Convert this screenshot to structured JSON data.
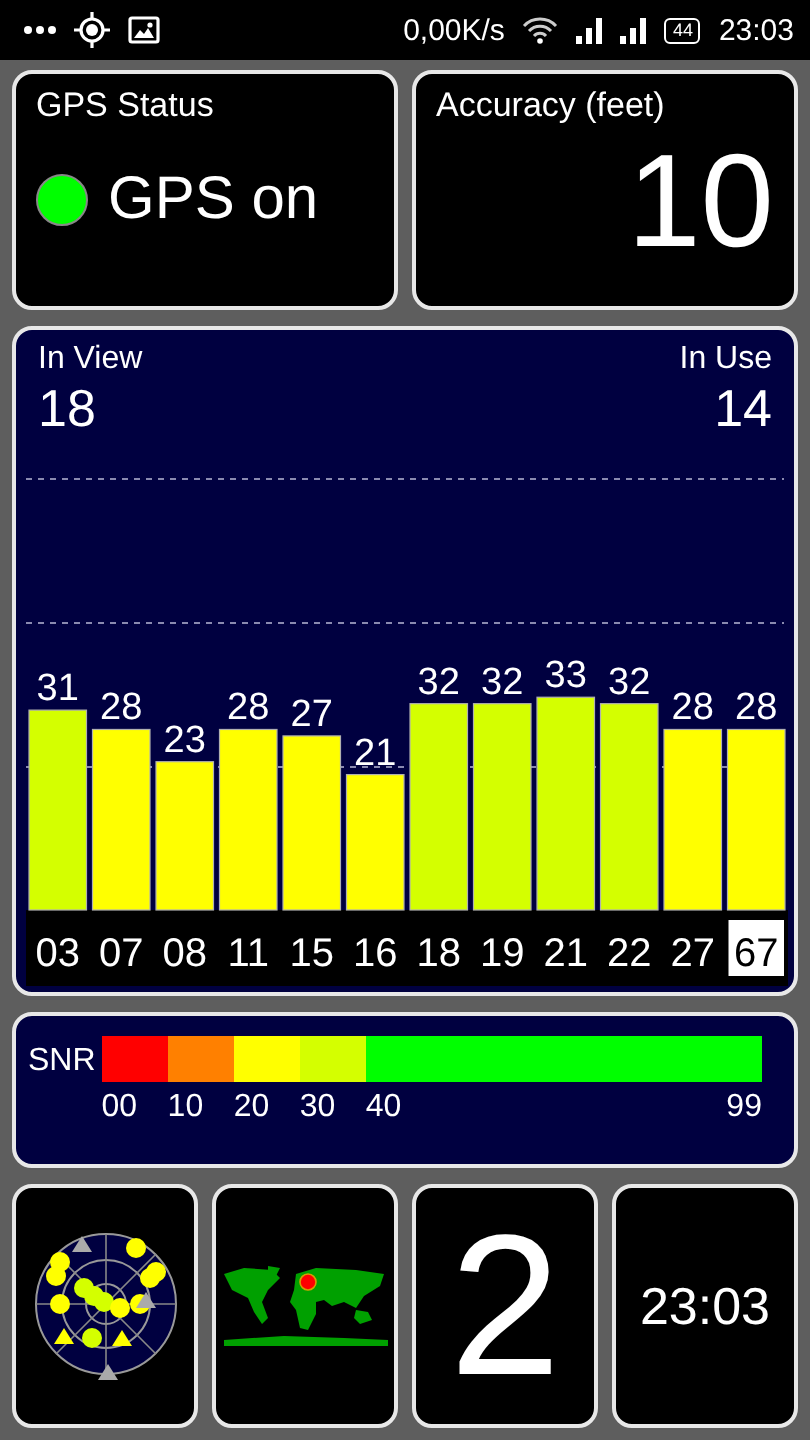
{
  "status_bar": {
    "net_speed": "0,00K/s",
    "battery": "44",
    "time": "23:03"
  },
  "gps_status": {
    "title": "GPS Status",
    "label": "GPS on",
    "on": true
  },
  "accuracy": {
    "title": "Accuracy (feet)",
    "value": "10"
  },
  "satellites": {
    "in_view_label": "In View",
    "in_view": "18",
    "in_use_label": "In Use",
    "in_use": "14",
    "chart_data": {
      "type": "bar",
      "categories": [
        "03",
        "07",
        "08",
        "11",
        "15",
        "16",
        "18",
        "19",
        "21",
        "22",
        "27",
        "67"
      ],
      "series": [
        {
          "values": [
            31,
            28,
            23,
            28,
            27,
            21,
            32,
            32,
            33,
            32,
            28,
            28
          ]
        }
      ],
      "ylim": [
        0,
        67
      ],
      "data_labels": true
    },
    "bar_states": [
      {
        "in_use": true,
        "selected": false
      },
      {
        "in_use": false,
        "selected": false
      },
      {
        "in_use": false,
        "selected": false
      },
      {
        "in_use": false,
        "selected": false
      },
      {
        "in_use": false,
        "selected": false
      },
      {
        "in_use": false,
        "selected": false
      },
      {
        "in_use": true,
        "selected": false
      },
      {
        "in_use": true,
        "selected": false
      },
      {
        "in_use": true,
        "selected": false
      },
      {
        "in_use": true,
        "selected": false
      },
      {
        "in_use": false,
        "selected": false
      },
      {
        "in_use": false,
        "selected": true
      }
    ]
  },
  "snr_legend": {
    "title": "SNR",
    "segments": [
      {
        "label": "00",
        "color": "#ff0000"
      },
      {
        "label": "10",
        "color": "#ff8000"
      },
      {
        "label": "20",
        "color": "#ffff00"
      },
      {
        "label": "30",
        "color": "#d4ff00"
      },
      {
        "label": "40",
        "color": "#00ff00"
      }
    ],
    "max_label": "99"
  },
  "tiles": [
    {
      "kind": "sky"
    },
    {
      "kind": "map"
    },
    {
      "kind": "number",
      "value": "2"
    },
    {
      "kind": "clock",
      "value": "23:03"
    }
  ]
}
